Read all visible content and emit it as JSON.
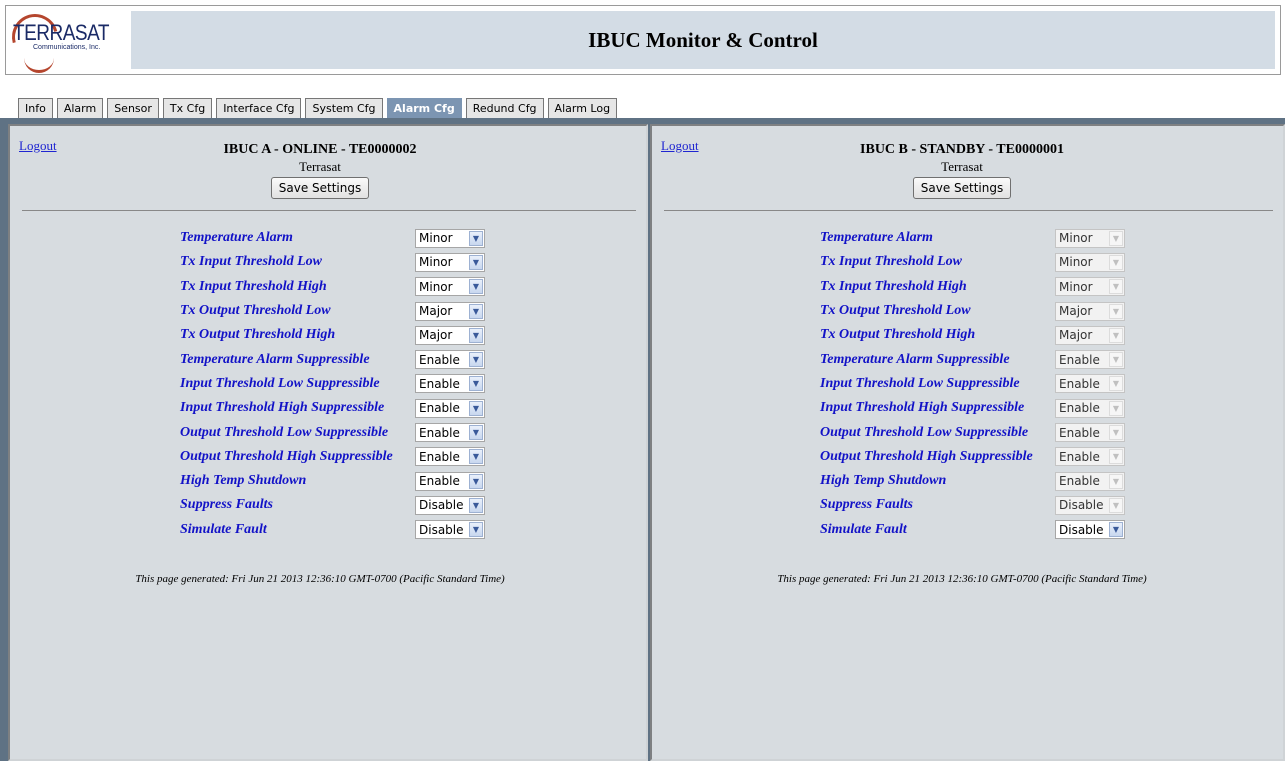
{
  "header": {
    "logo_text": "TERRASAT",
    "logo_sub": "Communications, Inc.",
    "title": "IBUC Monitor & Control"
  },
  "tabs": [
    {
      "label": "Info"
    },
    {
      "label": "Alarm"
    },
    {
      "label": "Sensor"
    },
    {
      "label": "Tx Cfg"
    },
    {
      "label": "Interface Cfg"
    },
    {
      "label": "System Cfg"
    },
    {
      "label": "Alarm Cfg",
      "active": true
    },
    {
      "label": "Redund Cfg"
    },
    {
      "label": "Alarm Log"
    }
  ],
  "panel_a": {
    "logout": "Logout",
    "title": "IBUC A - ONLINE - TE0000002",
    "name": "Terrasat",
    "save_label": "Save Settings",
    "rows": [
      {
        "label": "Temperature Alarm",
        "value": "Minor"
      },
      {
        "label": "Tx Input Threshold Low",
        "value": "Minor"
      },
      {
        "label": "Tx Input Threshold High",
        "value": "Minor"
      },
      {
        "label": "Tx Output Threshold Low",
        "value": "Major"
      },
      {
        "label": "Tx Output Threshold High",
        "value": "Major"
      },
      {
        "label": "Temperature Alarm Suppressible",
        "value": "Enable"
      },
      {
        "label": "Input Threshold Low Suppressible",
        "value": "Enable"
      },
      {
        "label": "Input Threshold High Suppressible",
        "value": "Enable"
      },
      {
        "label": "Output Threshold Low Suppressible",
        "value": "Enable"
      },
      {
        "label": "Output Threshold High Suppressible",
        "value": "Enable"
      },
      {
        "label": "High Temp Shutdown",
        "value": "Enable"
      },
      {
        "label": "Suppress Faults",
        "value": "Disable"
      },
      {
        "label": "Simulate Fault",
        "value": "Disable"
      }
    ],
    "generated": "This page generated: Fri Jun 21 2013 12:36:10 GMT-0700 (Pacific Standard Time)"
  },
  "panel_b": {
    "logout": "Logout",
    "title": "IBUC B - STANDBY - TE0000001",
    "name": "Terrasat",
    "save_label": "Save Settings",
    "rows": [
      {
        "label": "Temperature Alarm",
        "value": "Minor"
      },
      {
        "label": "Tx Input Threshold Low",
        "value": "Minor"
      },
      {
        "label": "Tx Input Threshold High",
        "value": "Minor"
      },
      {
        "label": "Tx Output Threshold Low",
        "value": "Major"
      },
      {
        "label": "Tx Output Threshold High",
        "value": "Major"
      },
      {
        "label": "Temperature Alarm Suppressible",
        "value": "Enable"
      },
      {
        "label": "Input Threshold Low Suppressible",
        "value": "Enable"
      },
      {
        "label": "Input Threshold High Suppressible",
        "value": "Enable"
      },
      {
        "label": "Output Threshold Low Suppressible",
        "value": "Enable"
      },
      {
        "label": "Output Threshold High Suppressible",
        "value": "Enable"
      },
      {
        "label": "High Temp Shutdown",
        "value": "Enable"
      },
      {
        "label": "Suppress Faults",
        "value": "Disable"
      },
      {
        "label": "Simulate Fault",
        "value": "Disable"
      }
    ],
    "generated": "This page generated: Fri Jun 21 2013 12:36:10 GMT-0700 (Pacific Standard Time)"
  },
  "colors": {
    "title_bar": "#d3dce5",
    "active_tab": "#7c95b2",
    "panel_bg": "#d7dce0",
    "label_blue": "#1212c7",
    "link_blue": "#1f25d1",
    "frame": "#5f7284"
  },
  "icons": {
    "dropdown_arrow": "chevron-down-icon",
    "logo": "terrasat-logo"
  }
}
